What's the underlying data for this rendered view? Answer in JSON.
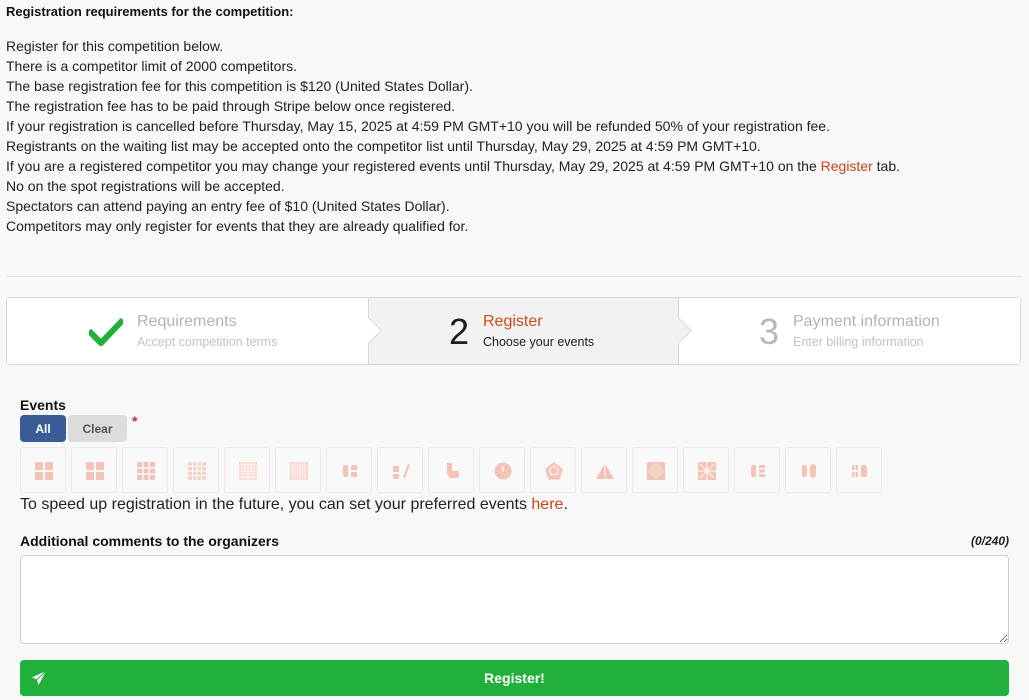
{
  "requirements": {
    "title": "Registration requirements for the competition:",
    "lines": [
      "Register for this competition below.",
      "There is a competitor limit of 2000 competitors.",
      "The base registration fee for this competition is $120 (United States Dollar).",
      "The registration fee has to be paid through Stripe below once registered.",
      "If your registration is cancelled before Thursday, May 15, 2025 at 4:59 PM GMT+10 you will be refunded 50% of your registration fee.",
      "Registrants on the waiting list may be accepted onto the competitor list until Thursday, May 29, 2025 at 4:59 PM GMT+10."
    ],
    "change_events": {
      "prefix": "If you are a registered competitor you may change your registered events until Thursday, May 29, 2025 at 4:59 PM GMT+10 on the ",
      "link": "Register",
      "suffix": " tab."
    },
    "lines_after": [
      "No on the spot registrations will be accepted.",
      "Spectators can attend paying an entry fee of $10 (United States Dollar).",
      "Competitors may only register for events that they are already qualified for."
    ]
  },
  "steps": [
    {
      "number": "",
      "title": "Requirements",
      "description": "Accept competition terms",
      "state": "completed",
      "icon": "checkmark-icon"
    },
    {
      "number": "2",
      "title": "Register",
      "description": "Choose your events",
      "state": "active"
    },
    {
      "number": "3",
      "title": "Payment information",
      "description": "Enter billing information",
      "state": "disabled"
    }
  ],
  "events": {
    "label": "Events",
    "all_label": "All",
    "clear_label": "Clear",
    "required_mark": "*",
    "icons": [
      "event-222-icon",
      "event-333-icon",
      "event-444-icon",
      "event-555-icon",
      "event-666-icon",
      "event-777-icon",
      "event-333bf-icon",
      "event-333fm-icon",
      "event-333oh-icon",
      "event-clock-icon",
      "event-minx-icon",
      "event-pyram-icon",
      "event-skewb-icon",
      "event-sq1-icon",
      "event-444bf-icon",
      "event-555bf-icon",
      "event-333mbf-icon"
    ]
  },
  "preferred": {
    "prefix": "To speed up registration in the future, you can set your preferred events ",
    "link": "here",
    "suffix": "."
  },
  "comments": {
    "label": "Additional comments to the organizers",
    "count": "(0/240)",
    "value": ""
  },
  "submit": {
    "label": "Register!",
    "icon": "paper-plane-icon"
  },
  "colors": {
    "accent": "#c84315",
    "primary": "#3a5b96",
    "success": "#22b03c",
    "required": "#c1272d"
  }
}
